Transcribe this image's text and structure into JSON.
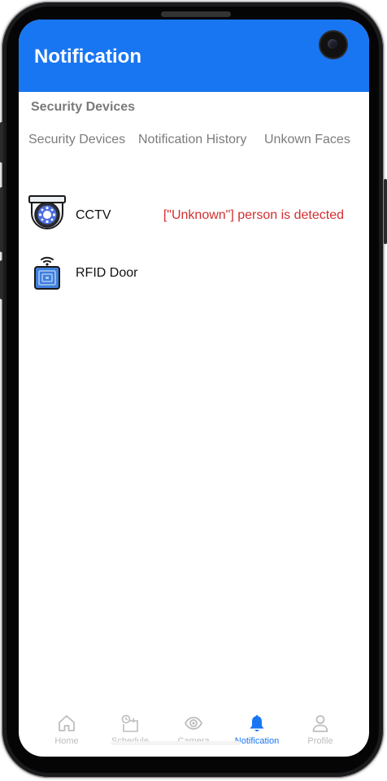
{
  "header": {
    "title": "Notification"
  },
  "section": {
    "title": "Security Devices"
  },
  "tabs": [
    {
      "label": "Security Devices"
    },
    {
      "label": "Notification History"
    },
    {
      "label": "Unkown Faces"
    }
  ],
  "devices": [
    {
      "name": "CCTV",
      "icon": "cctv-camera-icon",
      "alert": "[\"Unknown\"]  person is detected"
    },
    {
      "name": "RFID Door",
      "icon": "rfid-card-icon",
      "alert": ""
    }
  ],
  "bottom_nav": [
    {
      "label": "Home",
      "icon": "home-icon",
      "active": false
    },
    {
      "label": "Schedule",
      "icon": "schedule-icon",
      "active": false
    },
    {
      "label": "Camera",
      "icon": "eye-icon",
      "active": false
    },
    {
      "label": "Notification",
      "icon": "bell-icon",
      "active": true
    },
    {
      "label": "Profile",
      "icon": "profile-icon",
      "active": false
    }
  ],
  "colors": {
    "primary": "#1976f2",
    "alert": "#d32f2f",
    "inactive": "#bdbdbd"
  }
}
